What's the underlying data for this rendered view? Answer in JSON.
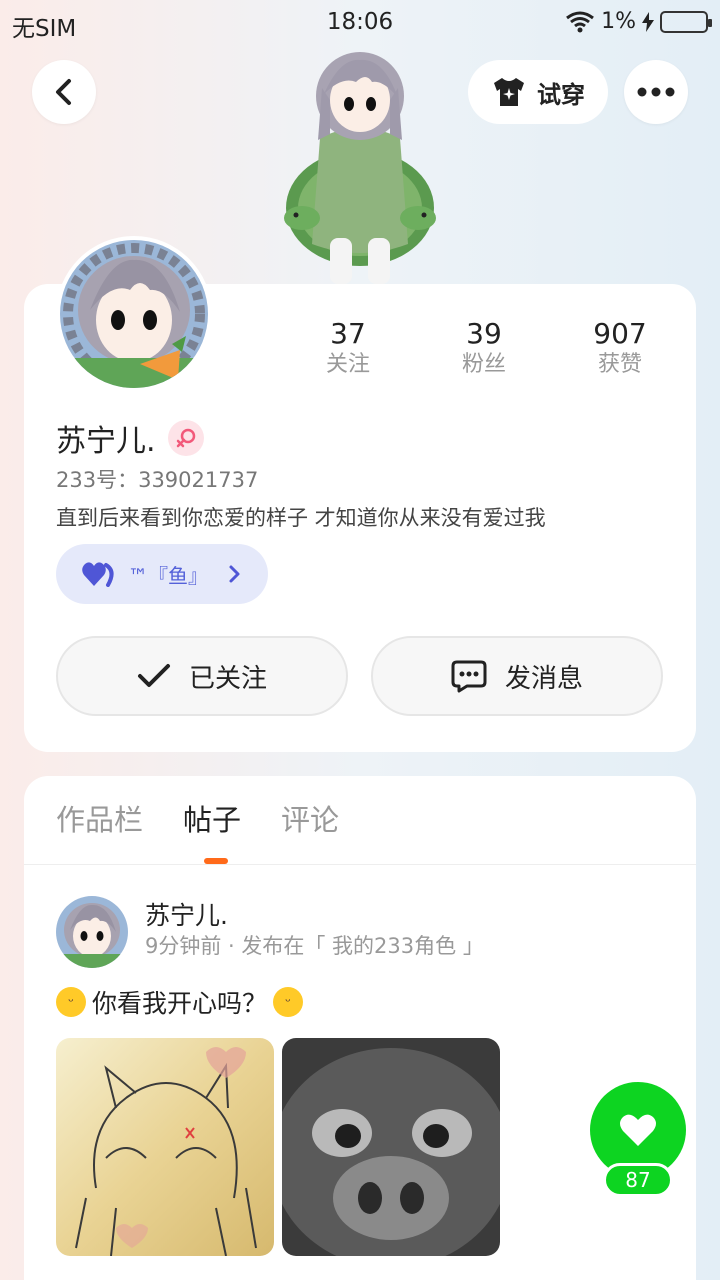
{
  "status_bar": {
    "carrier": "无SIM",
    "time": "18:06",
    "battery": "1%"
  },
  "topbar": {
    "try_on_label": "试穿"
  },
  "profile": {
    "stats": [
      {
        "value": "37",
        "label": "关注"
      },
      {
        "value": "39",
        "label": "粉丝"
      },
      {
        "value": "907",
        "label": "获赞"
      }
    ],
    "name": "苏宁儿.",
    "uid": "233号：339021737",
    "bio": "直到后来看到你恋爱的样子 才知道你从来没有爱过我",
    "tag": "™『鱼』",
    "follow_label": "已关注",
    "message_label": "发消息"
  },
  "tabs": [
    {
      "label": "作品栏",
      "active": false
    },
    {
      "label": "帖子",
      "active": true
    },
    {
      "label": "评论",
      "active": false
    }
  ],
  "post": {
    "author": "苏宁儿.",
    "meta": "9分钟前 · 发布在「 我的233角色 」",
    "text": "你看我开心吗？"
  },
  "like": {
    "count": "87"
  },
  "colors": {
    "accent_orange": "#ff6a1a",
    "like_green": "#0dd421",
    "tag_bg": "#e5e9fa",
    "tag_text": "#5461d9"
  },
  "icons": {
    "back": "chevron-left-icon",
    "try_on": "shirt-sparkle-icon",
    "more": "more-dots-icon",
    "gender": "female-icon",
    "tag": "heart-icon",
    "follow": "check-icon",
    "message": "chat-bubble-icon",
    "like": "heart-icon"
  }
}
